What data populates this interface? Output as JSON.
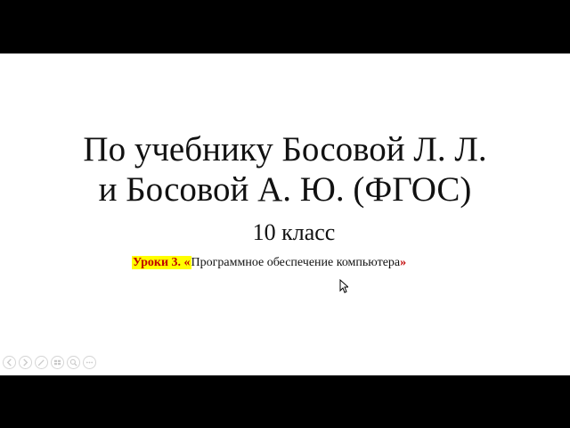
{
  "slide": {
    "title_line1": "По учебнику Босовой Л. Л.",
    "title_line2": "и Босовой А. Ю. (ФГОС)",
    "grade": "10 класс",
    "lesson_prefix": "Уроки 3. «",
    "lesson_title": "Программное обеспечение компьютера",
    "lesson_suffix": "»"
  },
  "controls": [
    {
      "icon": "previous-icon"
    },
    {
      "icon": "next-icon"
    },
    {
      "icon": "pen-icon"
    },
    {
      "icon": "slides-icon"
    },
    {
      "icon": "zoom-icon"
    },
    {
      "icon": "more-icon"
    }
  ],
  "colors": {
    "highlight": "#ffff00",
    "accent_red": "#c00000",
    "text": "#111111",
    "background": "#ffffff",
    "letterbox": "#000000"
  }
}
